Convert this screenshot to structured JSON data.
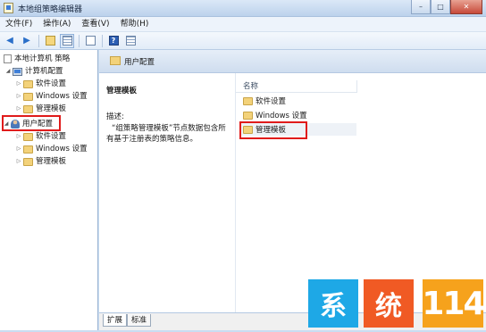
{
  "window": {
    "title": "本地组策略编辑器",
    "controls": {
      "minimize": "–",
      "maximize": "□",
      "close": "✕"
    }
  },
  "menubar": {
    "items": [
      "文件(F)",
      "操作(A)",
      "查看(V)",
      "帮助(H)"
    ]
  },
  "toolbar": {
    "icons": [
      "back-icon",
      "forward-icon",
      "up-folder-icon",
      "show-hide-tree-icon",
      "export-list-icon",
      "help-icon",
      "filter-icon"
    ]
  },
  "tree": {
    "root": "本地计算机 策略",
    "computer_config": {
      "label": "计算机配置",
      "children": [
        "软件设置",
        "Windows 设置",
        "管理模板"
      ]
    },
    "user_config": {
      "label": "用户配置",
      "children": [
        "软件设置",
        "Windows 设置",
        "管理模板"
      ]
    }
  },
  "content": {
    "header_title": "用户配置",
    "desc_title": "管理模板",
    "desc_label": "描述:",
    "desc_text": "“组策略管理模板”节点数据包含所有基于注册表的策略信息。",
    "column_name": "名称",
    "items": [
      "软件设置",
      "Windows 设置",
      "管理模板"
    ]
  },
  "tabs": [
    "扩展",
    "标准"
  ],
  "watermark": {
    "chars": [
      "系",
      "统",
      "114"
    ]
  },
  "colors": {
    "highlight": "#e01b1b",
    "watermark_blue": "#1ea8e6",
    "watermark_red": "#f05a24",
    "watermark_orange": "#f6a21c"
  }
}
